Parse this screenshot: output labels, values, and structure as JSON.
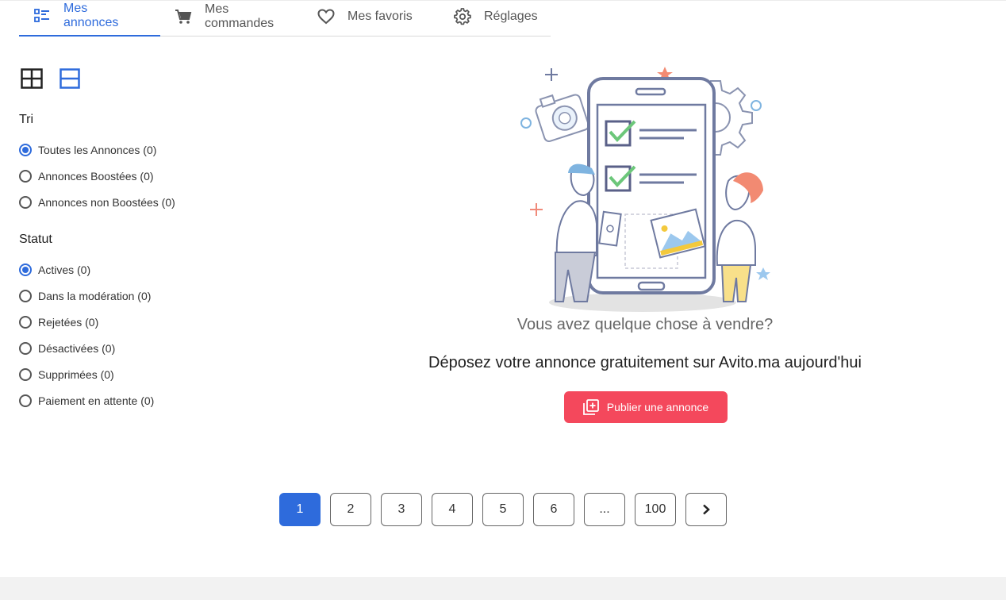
{
  "tabs": [
    {
      "label": "Mes annonces",
      "icon": "list-icon",
      "active": true
    },
    {
      "label": "Mes commandes",
      "icon": "cart-icon",
      "active": false
    },
    {
      "label": "Mes favoris",
      "icon": "heart-icon",
      "active": false
    },
    {
      "label": "Réglages",
      "icon": "gear-icon",
      "active": false
    }
  ],
  "view": {
    "grid_icon": "grid-view-icon",
    "list_icon": "list-view-icon",
    "selected": "list"
  },
  "filters": {
    "sort_title": "Tri",
    "sort_options": [
      {
        "label": "Toutes les Annonces (0)",
        "checked": true
      },
      {
        "label": "Annonces Boostées (0)",
        "checked": false
      },
      {
        "label": "Annonces non Boostées (0)",
        "checked": false
      }
    ],
    "status_title": "Statut",
    "status_options": [
      {
        "label": "Actives (0)",
        "checked": true
      },
      {
        "label": "Dans la modération (0)",
        "checked": false
      },
      {
        "label": "Rejetées (0)",
        "checked": false
      },
      {
        "label": "Désactivées (0)",
        "checked": false
      },
      {
        "label": "Supprimées (0)",
        "checked": false
      },
      {
        "label": "Paiement en attente (0)",
        "checked": false
      }
    ]
  },
  "empty_state": {
    "title": "Vous avez quelque chose à vendre?",
    "subtitle": "Déposez votre annonce gratuitement sur Avito.ma aujourd'hui",
    "button_label": "Publier une annonce"
  },
  "pagination": {
    "pages": [
      "1",
      "2",
      "3",
      "4",
      "5",
      "6",
      "...",
      "100"
    ],
    "current": "1",
    "next_icon": "chevron-right-icon"
  },
  "colors": {
    "accent": "#2e6bdc",
    "publish": "#f4485c"
  }
}
